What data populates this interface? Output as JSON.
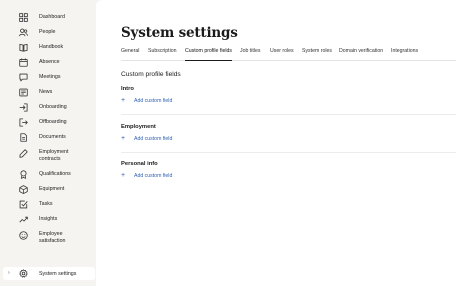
{
  "sidebar": {
    "items": [
      {
        "label": "Dashboard",
        "icon": "grid-icon"
      },
      {
        "label": "People",
        "icon": "people-icon"
      },
      {
        "label": "Handbook",
        "icon": "book-icon"
      },
      {
        "label": "Absence",
        "icon": "calendar-icon"
      },
      {
        "label": "Meetings",
        "icon": "chat-icon"
      },
      {
        "label": "News",
        "icon": "news-icon"
      },
      {
        "label": "Onboarding",
        "icon": "onboarding-icon"
      },
      {
        "label": "Offboarding",
        "icon": "offboarding-icon"
      },
      {
        "label": "Documents",
        "icon": "document-icon"
      },
      {
        "label": "Employment contracts",
        "line1": "Employment",
        "line2": "contracts",
        "icon": "contract-icon"
      },
      {
        "label": "Qualifications",
        "icon": "qualification-icon"
      },
      {
        "label": "Equipment",
        "icon": "equipment-icon"
      },
      {
        "label": "Tasks",
        "icon": "task-icon"
      },
      {
        "label": "Insights",
        "icon": "insights-icon"
      },
      {
        "label": "Employee satisfaction",
        "line1": "Employee",
        "line2": "satisfaction",
        "icon": "satisfaction-icon"
      }
    ],
    "footer": {
      "label": "System settings",
      "icon": "gear-icon",
      "caret": "›"
    }
  },
  "main": {
    "title": "System settings",
    "tabs": [
      {
        "label": "General"
      },
      {
        "label": "Subscription"
      },
      {
        "label": "Custom profile fields",
        "active": true
      },
      {
        "label": "Job titles"
      },
      {
        "label": "User roles"
      },
      {
        "label": "System roles"
      },
      {
        "label": "Domain verification"
      },
      {
        "label": "Integrations"
      }
    ],
    "section_title": "Custom profile fields",
    "groups": [
      {
        "title": "Intro",
        "add_label": "Add custom field"
      },
      {
        "title": "Employment",
        "add_label": "Add custom field"
      },
      {
        "title": "Personal info",
        "add_label": "Add custom field"
      }
    ]
  },
  "colors": {
    "sidebar_bg": "#f6f4f1",
    "main_bg": "#ffffff",
    "link": "#2f5fb3",
    "text": "#1b1b1b"
  }
}
